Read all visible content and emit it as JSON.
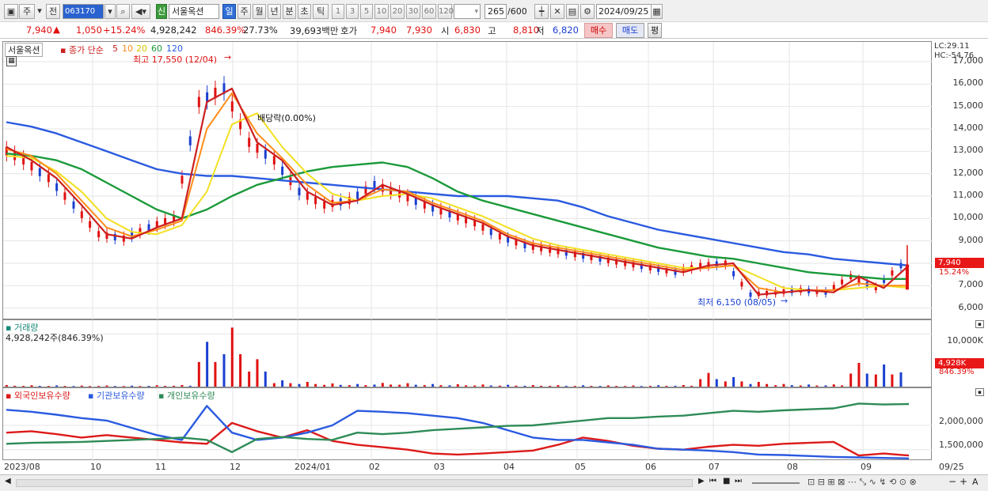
{
  "toolbar": {
    "period": "주",
    "prev": "전",
    "stock_code": "063170",
    "mode_tag": "신",
    "stock_name": "서울옥션",
    "timeframes": [
      "일",
      "주",
      "월",
      "년",
      "분",
      "초",
      "틱"
    ],
    "minute_options": [
      "1",
      "3",
      "5",
      "10",
      "20",
      "30",
      "60",
      "120"
    ],
    "count": "265",
    "count_total": "/600",
    "date": "2024/09/25"
  },
  "quote": {
    "price": "7,940",
    "change": "1,050",
    "change_pct": "+15.24%",
    "volume": "4,928,242",
    "volume_ratio": "846.39%",
    "turnover": "27.73%",
    "amount": "39,693백만",
    "bid_ask_label": "호가",
    "ask": "7,940",
    "bid": "7,930",
    "open_label": "시",
    "open": "6,830",
    "high_label": "고",
    "high": "8,810",
    "low_label": "저",
    "low": "6,820",
    "buy_label": "매수",
    "sell_label": "매도",
    "eval_label": "평"
  },
  "price_pane": {
    "stock_tag": "서울옥션",
    "ma_title": "종가 단순",
    "ma_periods": [
      {
        "label": "5",
        "color": "#cc2020"
      },
      {
        "label": "10",
        "color": "#ff8c1a"
      },
      {
        "label": "20",
        "color": "#f2e020"
      },
      {
        "label": "60",
        "color": "#1a9a3a"
      },
      {
        "label": "120",
        "color": "#2a5ae0"
      }
    ],
    "high_note": "최고 17,550 (12/04)",
    "low_note": "최저 6,150 (08/05)",
    "dividend_note": "배당락(0.00%)",
    "lc": "LC:29.11",
    "hc": "HC:-54.76",
    "y_ticks": [
      "17,000",
      "16,000",
      "15,000",
      "14,000",
      "13,000",
      "12,000",
      "11,000",
      "10,000",
      "9,000",
      "8,000",
      "7,000",
      "6,000"
    ],
    "last_price_tag": "7,940",
    "last_pct": "15.24%"
  },
  "volume_pane": {
    "title": "거래량",
    "value": "4,928,242주(846.39%)",
    "y_tick": "10,000K",
    "last_tag": "4,928K",
    "last_pct": "846.39%"
  },
  "holding_pane": {
    "series": [
      {
        "name": "외국인보유수량",
        "color": "#dd1a1a"
      },
      {
        "name": "기관보유수량",
        "color": "#2a5ae0"
      },
      {
        "name": "개인보유수량",
        "color": "#2e8b57"
      }
    ],
    "y_ticks": [
      "2,000,000",
      "1,500,000"
    ]
  },
  "x_labels": [
    "2023/08",
    "10",
    "11",
    "12",
    "2024/01",
    "02",
    "03",
    "04",
    "05",
    "06",
    "07",
    "08",
    "09",
    "09/25"
  ],
  "colors": {
    "up": "#e01010",
    "down": "#1a3fd0",
    "grid": "#e6e6e6"
  },
  "chart_data": [
    {
      "type": "candlestick",
      "ylim": [
        5600,
        17600
      ],
      "ma_series": [
        {
          "name": "5",
          "values": [
            13200,
            12600,
            11800,
            10600,
            9300,
            9100,
            9600,
            10000,
            15200,
            15800,
            13400,
            12600,
            11200,
            10600,
            10800,
            11500,
            11100,
            10600,
            10200,
            9800,
            9200,
            8800,
            8600,
            8400,
            8200,
            8000,
            7800,
            7600,
            7900,
            8000,
            6600,
            6700,
            6800,
            6700,
            7400,
            6900,
            7900
          ]
        },
        {
          "name": "10",
          "values": [
            13100,
            12800,
            12000,
            10800,
            9600,
            9200,
            9500,
            9900,
            14000,
            15600,
            13800,
            12700,
            11500,
            10700,
            10800,
            11300,
            11200,
            10700,
            10300,
            9900,
            9300,
            8900,
            8700,
            8500,
            8300,
            8100,
            7900,
            7700,
            7800,
            7900,
            6900,
            6700,
            6800,
            6800,
            7100,
            7000,
            7000
          ]
        },
        {
          "name": "20",
          "values": [
            12800,
            12700,
            12100,
            11200,
            10000,
            9400,
            9300,
            9700,
            11200,
            14200,
            14700,
            13200,
            12000,
            11100,
            10800,
            11000,
            11100,
            10900,
            10500,
            10100,
            9600,
            9100,
            8800,
            8600,
            8400,
            8200,
            8000,
            7800,
            7800,
            7900,
            7400,
            6900,
            6800,
            6800,
            6900,
            7000,
            6900
          ]
        },
        {
          "name": "60",
          "values": [
            12900,
            12800,
            12600,
            12200,
            11600,
            11000,
            10400,
            10000,
            10400,
            11000,
            11500,
            11800,
            12100,
            12300,
            12400,
            12500,
            12300,
            11800,
            11200,
            10800,
            10500,
            10200,
            9900,
            9600,
            9300,
            9000,
            8700,
            8500,
            8300,
            8200,
            8000,
            7800,
            7600,
            7500,
            7400,
            7300,
            7300
          ]
        },
        {
          "name": "120",
          "values": [
            14300,
            14100,
            13800,
            13400,
            13000,
            12600,
            12200,
            12000,
            11900,
            11900,
            11800,
            11700,
            11600,
            11500,
            11400,
            11300,
            11200,
            11100,
            11000,
            11000,
            11000,
            10900,
            10800,
            10500,
            10100,
            9800,
            9500,
            9300,
            9100,
            8900,
            8700,
            8500,
            8400,
            8200,
            8100,
            8000,
            7900
          ]
        }
      ],
      "high": {
        "value": 17550,
        "date": "12/04"
      },
      "low": {
        "value": 6150,
        "date": "08/05"
      },
      "last": 7940
    },
    {
      "type": "bar",
      "name": "거래량",
      "ylim": [
        0,
        12000000
      ],
      "values": [
        300,
        260,
        240,
        200,
        220,
        180,
        260,
        300,
        8500,
        11200,
        5200,
        1200,
        900,
        600,
        500,
        700,
        650,
        500,
        450,
        400,
        350,
        300,
        280,
        260,
        240,
        220,
        260,
        300,
        2600,
        1800,
        900,
        500,
        400,
        420,
        4500,
        4200,
        4928
      ]
    },
    {
      "type": "line",
      "ylim": [
        1300000,
        2700000
      ],
      "series": [
        {
          "name": "외국인보유수량",
          "values": [
            1850000,
            1880000,
            1820000,
            1750000,
            1800000,
            1750000,
            1700000,
            1650000,
            1620000,
            2050000,
            1880000,
            1750000,
            1900000,
            1680000,
            1600000,
            1550000,
            1500000,
            1420000,
            1400000,
            1420000,
            1450000,
            1480000,
            1600000,
            1750000,
            1680000,
            1580000,
            1520000,
            1500000,
            1560000,
            1600000,
            1580000,
            1620000,
            1640000,
            1660000,
            1380000,
            1420000,
            1380000
          ]
        },
        {
          "name": "기관보유수량",
          "values": [
            2320000,
            2280000,
            2220000,
            2150000,
            2100000,
            1950000,
            1800000,
            1700000,
            2400000,
            1850000,
            1700000,
            1750000,
            1850000,
            2000000,
            2300000,
            2280000,
            2250000,
            2200000,
            2150000,
            2050000,
            1900000,
            1750000,
            1700000,
            1700000,
            1650000,
            1600000,
            1520000,
            1500000,
            1480000,
            1450000,
            1400000,
            1390000,
            1370000,
            1350000,
            1340000,
            1330000,
            1320000
          ]
        },
        {
          "name": "개인보유수량",
          "values": [
            1620000,
            1640000,
            1650000,
            1660000,
            1680000,
            1700000,
            1720000,
            1750000,
            1700000,
            1450000,
            1720000,
            1760000,
            1720000,
            1700000,
            1850000,
            1820000,
            1850000,
            1900000,
            1930000,
            1960000,
            1990000,
            2000000,
            2050000,
            2100000,
            2150000,
            2150000,
            2180000,
            2200000,
            2250000,
            2300000,
            2280000,
            2310000,
            2330000,
            2350000,
            2450000,
            2430000,
            2440000
          ]
        }
      ]
    }
  ]
}
